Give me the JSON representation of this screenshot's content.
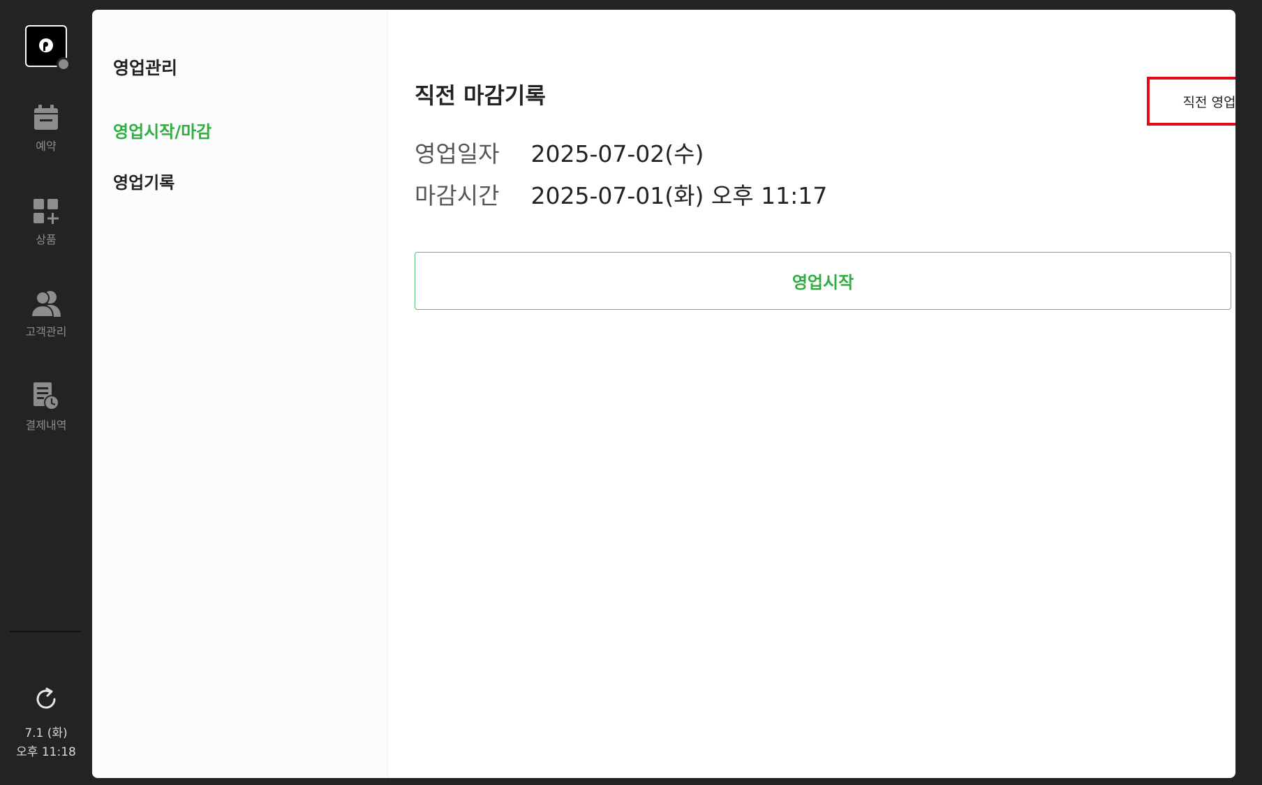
{
  "rail": {
    "items": [
      {
        "label": "예약",
        "icon": "calendar-icon"
      },
      {
        "label": "상품",
        "icon": "product-add-icon"
      },
      {
        "label": "고객관리",
        "icon": "customers-icon"
      },
      {
        "label": "결제내역",
        "icon": "payment-history-icon"
      }
    ],
    "clock": {
      "date": "7.1 (화)",
      "time": "오후 11:18"
    }
  },
  "subnav": {
    "title": "영업관리",
    "items": [
      {
        "label": "영업시작/마감",
        "active": true
      },
      {
        "label": "영업기록",
        "active": false
      }
    ]
  },
  "main": {
    "title": "직전 마감기록",
    "cancel_label": "직전 영업마감 취소",
    "business_date_label": "영업일자",
    "business_date_value": "2025-07-02(수)",
    "closing_time_label": "마감시간",
    "closing_time_value": "2025-07-01(화) 오후 11:17",
    "start_label": "영업시작"
  },
  "colors": {
    "accent_green": "#2fae3f",
    "highlight_red": "#e30b17",
    "rail_bg": "#232323"
  }
}
